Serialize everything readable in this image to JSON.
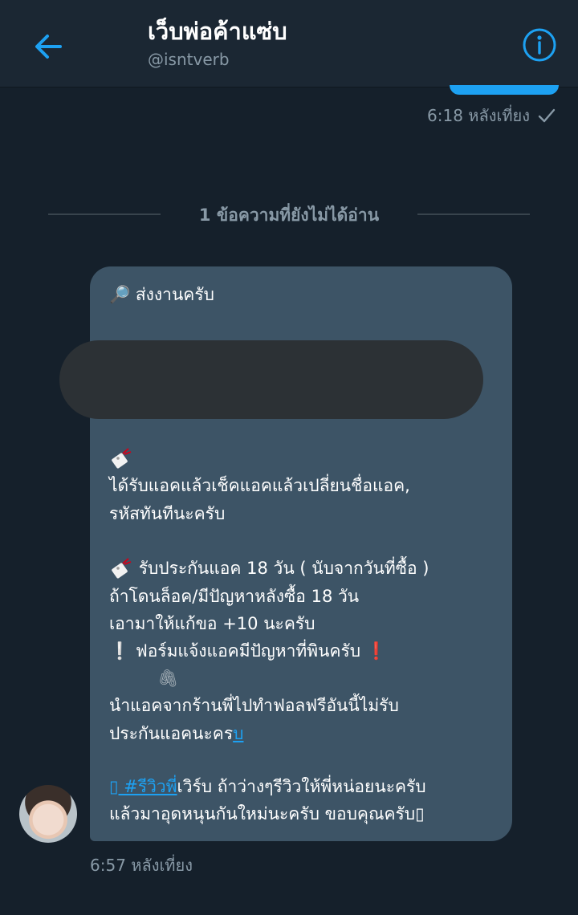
{
  "header": {
    "title": "เว็บพ่อค้าแซ่บ",
    "handle": "@isntverb",
    "accent_color": "#1da1f2",
    "back_icon": "arrow-left-icon",
    "info_icon": "info-icon"
  },
  "sent_message": {
    "time": "6:18 หลังเที่ยง",
    "status_icon": "check-icon"
  },
  "unread_divider": "1 ข้อความที่ยังไม่ได้อ่าน",
  "received_message": {
    "line_intro": "🔎 ส่งงานครับ",
    "line_1": "ได้รับแอคแล้วเช็คแอคแล้วเปลี่ยนชื่อแอค,",
    "line_2": "รหัสทันทีนะครับ",
    "line_3": "รับประกันแอค 18 วัน ( นับจากวันที่ซื้อ )",
    "line_4": "ถ้าโดนล็อค/มีปัญหาหลังซื้อ 18 วัน",
    "line_5": "เอามาให้แก้ขอ +10 นะครับ",
    "line_6_excl_left": "❕",
    "line_6": " ฟอร์มแจ้งแอคมีปัญหาที่พินครับ ",
    "line_6_excl_right": "❗",
    "paperclip": "🖇",
    "line_7": "นำแอคจากร้านพี่ไปทำฟอลฟรีอันนี้ไม่รับ",
    "line_8_text": "ประกันแอคนะคร",
    "line_8_link": "บ",
    "line_9_link": "▯ #รีวิวพี่",
    "line_9_text": "เวิร์บ ถ้าว่างๆรีวิวให้พี่หน่อยนะครับ",
    "line_10": "แล้วมาอุดหนุนกันใหม่นะครับ ขอบคุณครับ▯",
    "time": "6:57 หลังเที่ยง",
    "tag_icon": "tag-icon"
  },
  "colors": {
    "background": "#15202b",
    "bubble": "#3d5466",
    "muted": "#8899a6"
  }
}
